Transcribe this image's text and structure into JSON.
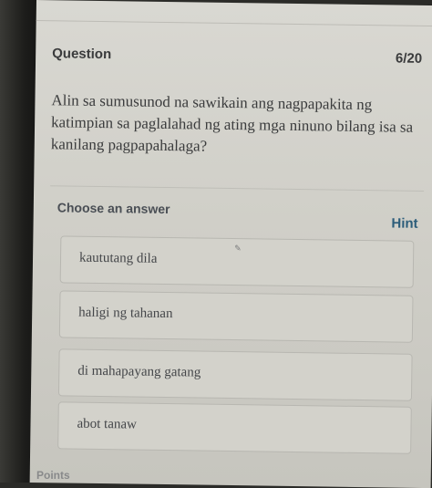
{
  "question": {
    "label": "Question",
    "counter": "6/20",
    "text": "Alin sa sumusunod na sawikain ang nagpapakita ng katimpian sa paglalahad ng ating mga ninuno bilang isa sa kanilang pagpapahalaga?"
  },
  "answers": {
    "heading": "Choose an answer",
    "hint_label": "Hint",
    "options": [
      {
        "label": "kaututang dila"
      },
      {
        "label": "haligi ng tahanan"
      },
      {
        "label": "di mahapayang gatang"
      },
      {
        "label": "abot tanaw"
      }
    ]
  },
  "footer": {
    "points_label": "Points"
  },
  "colors": {
    "hint_link": "#2c5d7a",
    "screen_background": "#d3d2cb"
  }
}
